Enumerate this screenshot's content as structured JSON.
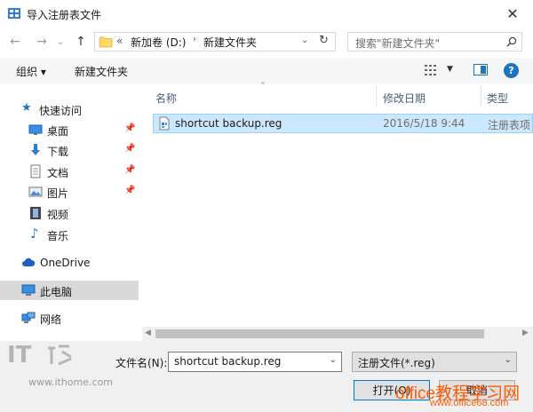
{
  "window": {
    "title": "导入注册表文件"
  },
  "nav": {
    "back": "←",
    "forward": "→",
    "recent": "⌄",
    "up": "↑",
    "breadcrumb_prefix": "«",
    "crumbs": [
      "新加卷 (D:)",
      "新建文件夹"
    ],
    "search_placeholder": "搜索\"新建文件夹\""
  },
  "toolbar": {
    "organize": "组织 ▾",
    "new_folder": "新建文件夹"
  },
  "sidebar": {
    "items": [
      {
        "label": "快速访问"
      },
      {
        "label": "桌面"
      },
      {
        "label": "下载"
      },
      {
        "label": "文档"
      },
      {
        "label": "图片"
      },
      {
        "label": "视频"
      },
      {
        "label": "音乐"
      },
      {
        "label": "OneDrive"
      },
      {
        "label": "此电脑"
      },
      {
        "label": "网络"
      }
    ]
  },
  "columns": {
    "name": "名称",
    "date": "修改日期",
    "type": "类型"
  },
  "files": [
    {
      "name": "shortcut backup.reg",
      "date": "2016/5/18 9:44",
      "type": "注册表项"
    }
  ],
  "bottom": {
    "filename_label": "文件名(N):",
    "filename_value": "shortcut backup.reg",
    "filetype_value": "注册文件(*.reg)",
    "open": "打开(O)",
    "cancel": "取消"
  },
  "watermarks": {
    "it": "IT",
    "ithome": "www.ithome.com",
    "office": "office教程学习网",
    "office_url": "www.office68.com"
  },
  "colors": {
    "selection": "#cce8ff",
    "accent": "#0078d7",
    "folder": "#ffd866",
    "help": "#1e73be"
  }
}
